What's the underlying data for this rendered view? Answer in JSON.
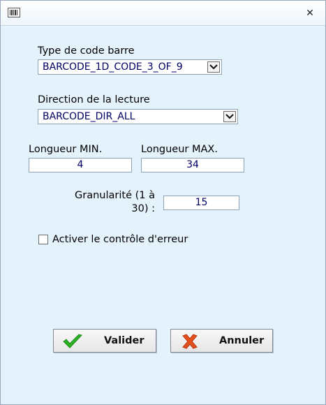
{
  "window": {
    "icon": "barcode-icon",
    "close_glyph": "✕"
  },
  "form": {
    "type_label": "Type de code barre",
    "type_value": "BARCODE_1D_CODE_3_OF_9",
    "direction_label": "Direction de la lecture",
    "direction_value": "BARCODE_DIR_ALL",
    "min_label": "Longueur MIN.",
    "min_value": "4",
    "max_label": "Longueur MAX.",
    "max_value": "34",
    "granularity_line1": "Granularité (1 à",
    "granularity_line2": "30) :",
    "granularity_value": "15",
    "error_check_label": "Activer le contrôle d'erreur",
    "error_check_checked": false
  },
  "buttons": {
    "validate_label": "Valider",
    "validate_icon": "checkmark-icon",
    "cancel_label": "Annuler",
    "cancel_icon": "cross-icon"
  },
  "colors": {
    "background": "#e4f2fb",
    "value_text": "#000066",
    "check_green": "#2db324",
    "cross_orange": "#e8501c"
  }
}
